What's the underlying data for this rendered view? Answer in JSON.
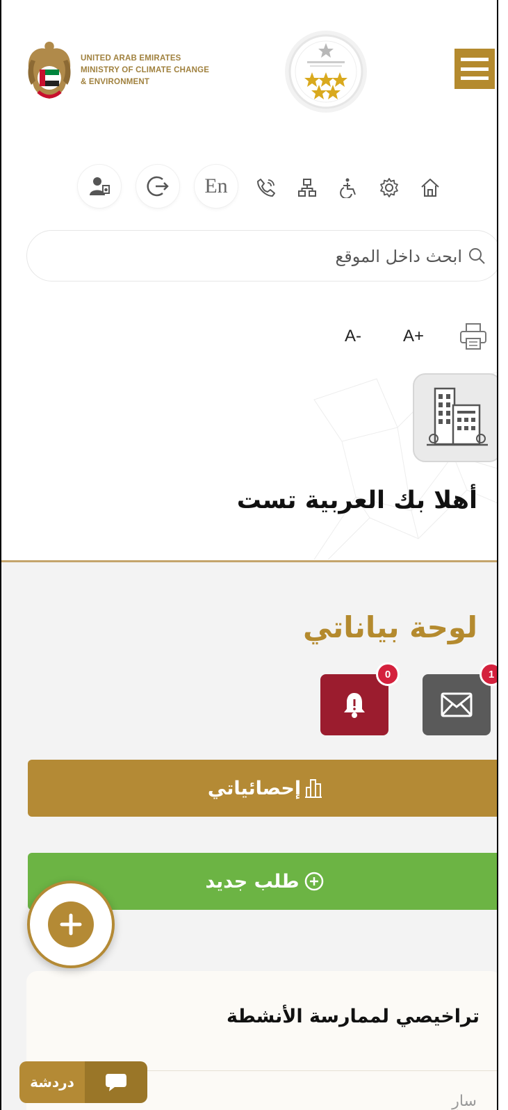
{
  "header": {
    "ministry_lines": [
      "UNITED ARAB EMIRATES",
      "MINISTRY OF CLIMATE CHANGE",
      "& ENVIRONMENT"
    ],
    "menu_icon": "hamburger-icon"
  },
  "utility": {
    "language_label": "En",
    "icons": [
      "home-icon",
      "settings-icon",
      "accessibility-icon",
      "sitemap-icon",
      "phone-icon",
      "logout-icon",
      "user-icon"
    ]
  },
  "search": {
    "placeholder": "ابحث داخل الموقع"
  },
  "font_size": {
    "increase": "A+",
    "decrease": "A-"
  },
  "profile": {
    "welcome": "أهلا بك العربية تست"
  },
  "dashboard": {
    "title": "لوحة بياناتي",
    "messages_count": "1",
    "notifications_count": "0",
    "stats_label": "إحصائياتي",
    "new_request_label": "طلب جديد"
  },
  "licenses_card": {
    "title": "تراخيصي لممارسة الأنشطة",
    "peek_text": "سارٍ"
  },
  "chat": {
    "label": "دردشة"
  },
  "colors": {
    "gold": "#b48a35",
    "green": "#6cb444",
    "maroon": "#9b1c2e",
    "dark_grey": "#5a5a5a",
    "badge_red": "#d4213d"
  }
}
